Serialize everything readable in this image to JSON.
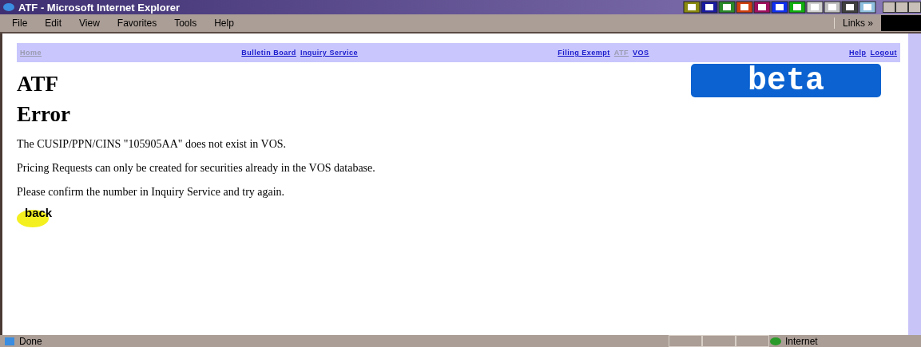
{
  "window": {
    "title": "ATF - Microsoft Internet Explorer"
  },
  "menu": [
    "File",
    "Edit",
    "View",
    "Favorites",
    "Tools",
    "Help"
  ],
  "links_bar": {
    "label": "Links",
    "chevron": "»"
  },
  "nav": {
    "groups": [
      [
        {
          "label": "Home",
          "disabled": true
        }
      ],
      [
        {
          "label": "Bulletin Board",
          "disabled": false
        },
        {
          "label": "Inquiry Service",
          "disabled": false
        }
      ],
      [
        {
          "label": "Filing Exempt",
          "disabled": false
        },
        {
          "label": "ATF",
          "disabled": true
        },
        {
          "label": "VOS",
          "disabled": false
        }
      ],
      [
        {
          "label": "Help",
          "disabled": false
        },
        {
          "label": "Logout",
          "disabled": false
        }
      ]
    ]
  },
  "page": {
    "title": "ATF",
    "badge": "beta",
    "heading": "Error",
    "paragraphs": [
      "The CUSIP/PPN/CINS \"105905AA\" does not exist in VOS.",
      "Pricing Requests can only be created for securities already in the VOS database.",
      "Please confirm the number in Inquiry Service and try again."
    ],
    "back_button": "back"
  },
  "status_bar": {
    "text": "Done",
    "zone": "Internet"
  }
}
